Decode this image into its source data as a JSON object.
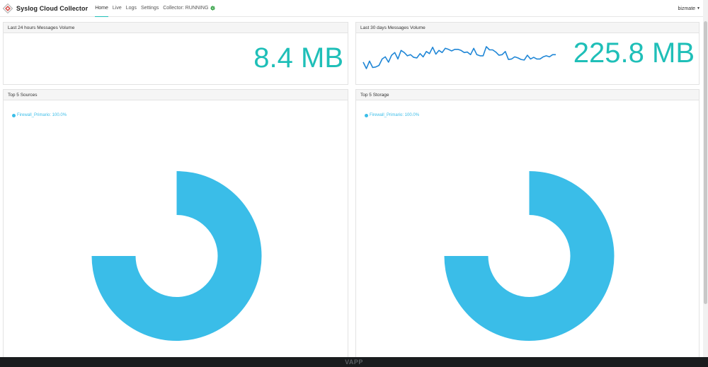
{
  "navbar": {
    "brand": "Syslog Cloud Collector",
    "items": [
      {
        "label": "Home",
        "active": true
      },
      {
        "label": "Live"
      },
      {
        "label": "Logs"
      },
      {
        "label": "Settings"
      }
    ],
    "collector_status": "Collector: RUNNING",
    "user": "bizmate"
  },
  "panels": {
    "volume_24h": {
      "title": "Last 24 hours Messages Volume",
      "value": "8.4 MB"
    },
    "volume_30d": {
      "title": "Last 30 days Messages Volume",
      "value": "225.8 MB"
    },
    "top_sources": {
      "title": "Top 5 Sources",
      "legend": "Firewall_Primario: 100.0%"
    },
    "top_storage": {
      "title": "Top 5 Storage",
      "legend": "Firewall_Primario: 100.0%"
    }
  },
  "footer": {
    "text": "VAPP"
  },
  "colors": {
    "accent": "#1fbfb8",
    "chart": "#3abde8",
    "line": "#1f86d6"
  },
  "chart_data": [
    {
      "type": "line",
      "series": [
        {
          "values": [
            72,
            60,
            74,
            62,
            63,
            66,
            78,
            82,
            72,
            85,
            90,
            78,
            94,
            90,
            84,
            86,
            81,
            80,
            88,
            82,
            92,
            88,
            100,
            87,
            94,
            90,
            98,
            96,
            93,
            96,
            96,
            94,
            90,
            91,
            86,
            98,
            86,
            84,
            84,
            101,
            95,
            95,
            91,
            85,
            86,
            92,
            77,
            78,
            82,
            80,
            77,
            76,
            85,
            78,
            81,
            78,
            78,
            82,
            84,
            82,
            86,
            86
          ]
        }
      ]
    },
    {
      "type": "pie",
      "categories": [
        "Firewall_Primario"
      ],
      "values": [
        100.0
      ]
    },
    {
      "type": "pie",
      "categories": [
        "Firewall_Primario"
      ],
      "values": [
        100.0
      ]
    }
  ]
}
